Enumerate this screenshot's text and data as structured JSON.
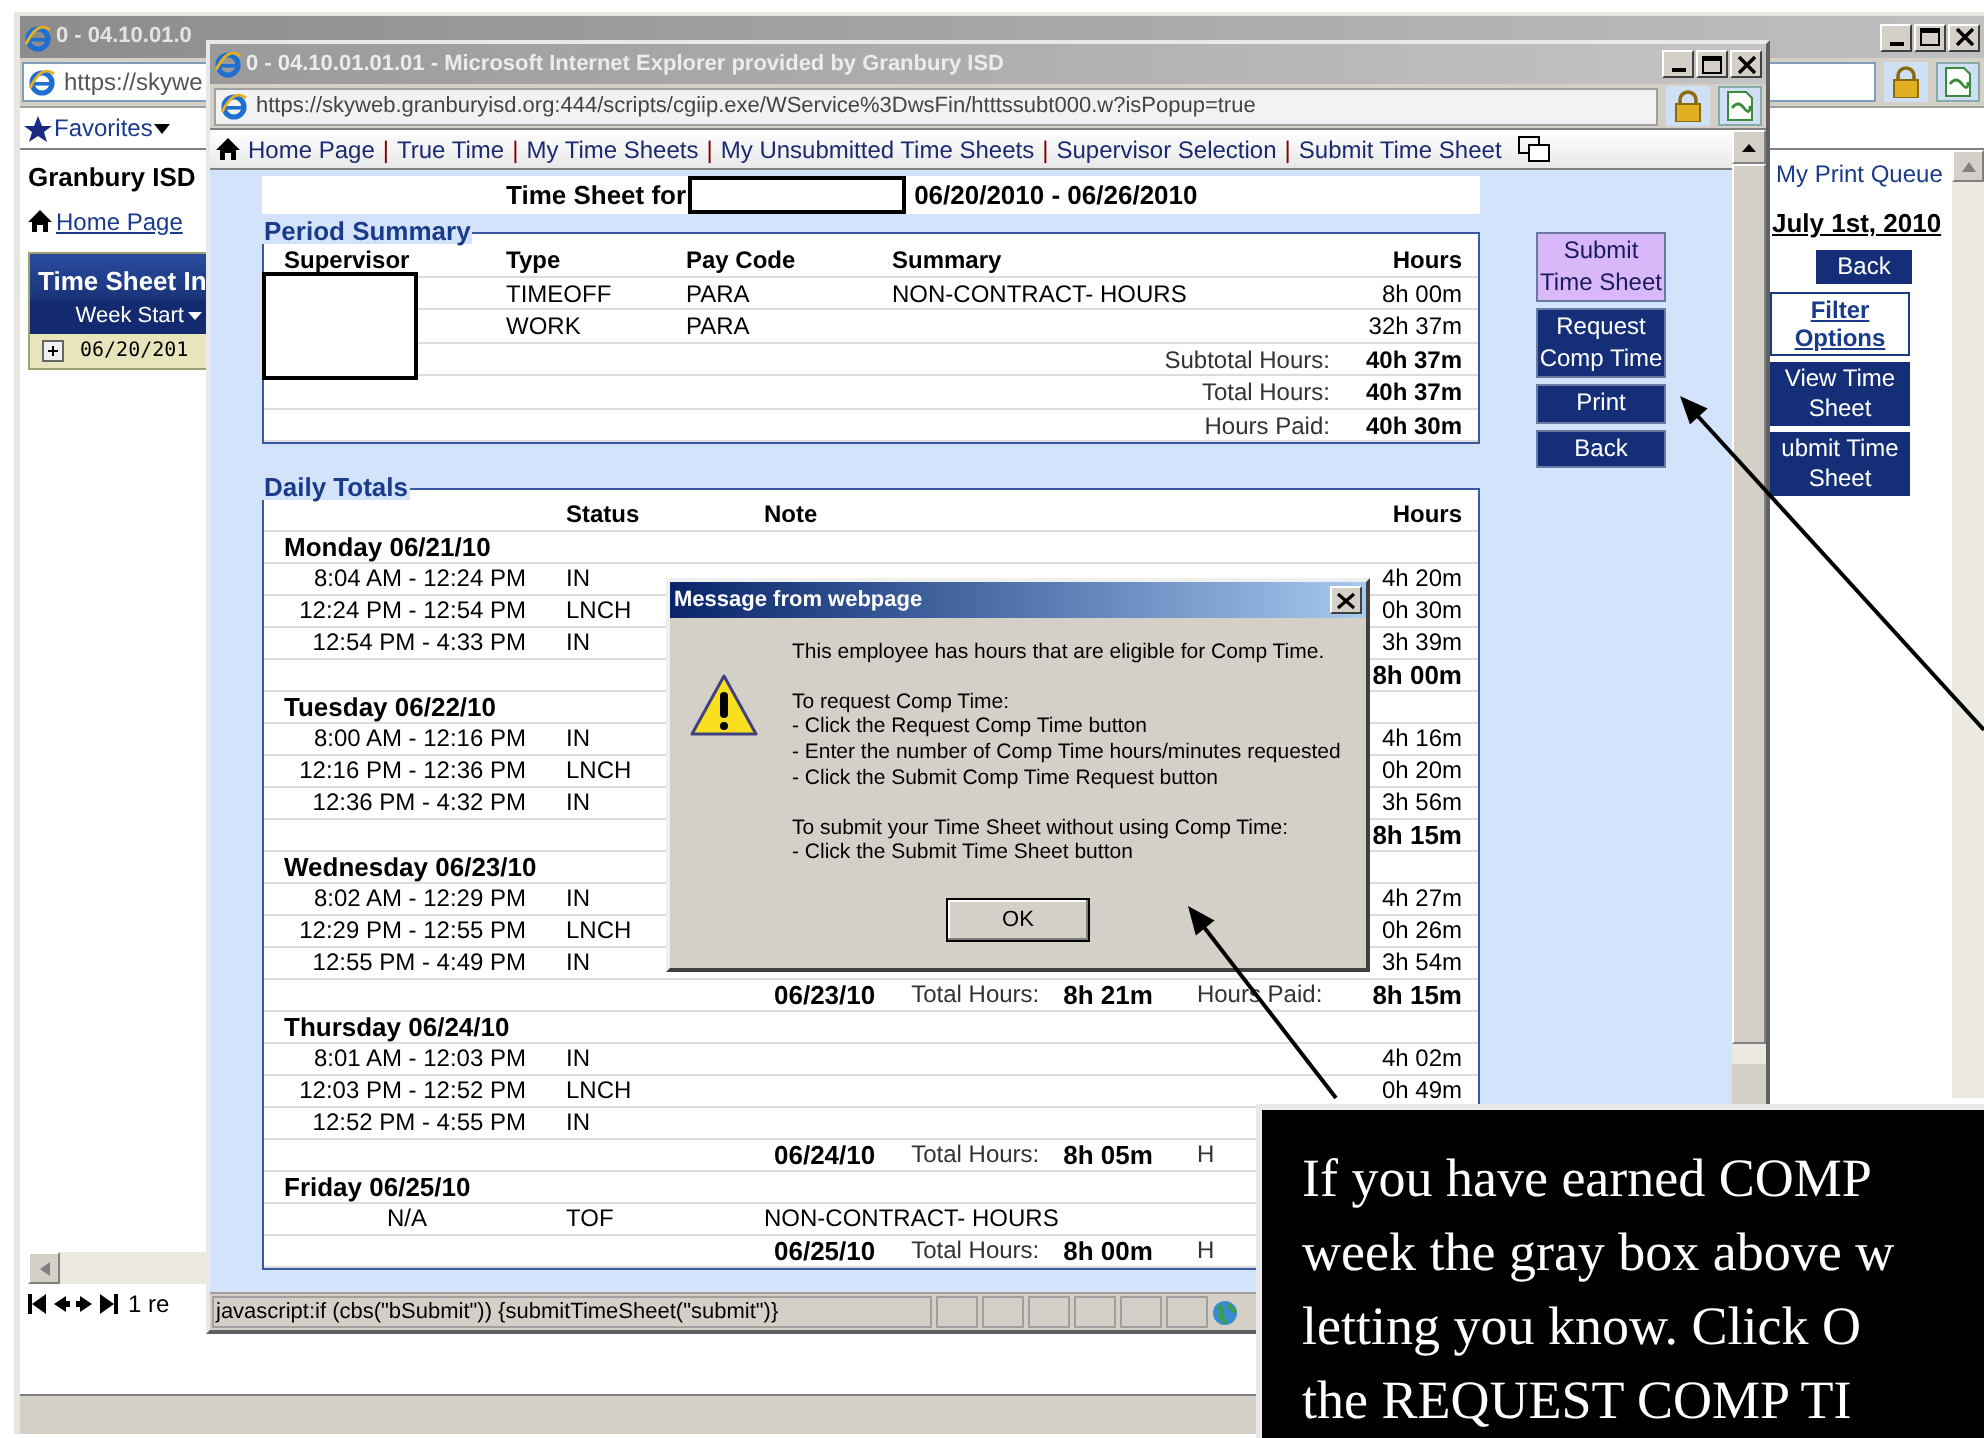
{
  "back_window": {
    "title": "0 - 04.10.01.0",
    "address": "https://skywe",
    "favorites": "Favorites",
    "organization": "Granbury ISD",
    "nav_link": "Home Page",
    "panel": {
      "title": "Time Sheet In",
      "column": "Week Start",
      "row": "06/20/201"
    },
    "print_queue": "My Print Queue",
    "date": "July 1st, 2010",
    "buttons": [
      {
        "label": "Back",
        "kind": "solid"
      },
      {
        "label": "Filter Options",
        "kind": "link"
      },
      {
        "label": "View Time Sheet",
        "kind": "solid"
      },
      {
        "label": "ubmit Time Sheet",
        "kind": "solid"
      }
    ],
    "pager": "1 re"
  },
  "popup_window": {
    "title": "0 - 04.10.01.01.01 - Microsoft Internet Explorer provided by Granbury ISD",
    "address": "https://skyweb.granburyisd.org:444/scripts/cgiip.exe/WService%3DwsFin/htttssubt000.w?isPopup=true",
    "nav_links": [
      "Home Page",
      "True Time",
      "My Time Sheets",
      "My Unsubmitted Time Sheets",
      "Supervisor Selection",
      "Submit Time Sheet"
    ],
    "nav_separators": [
      "|",
      "|",
      "|",
      "|",
      "|"
    ],
    "heading": {
      "label": "Time Sheet for",
      "period": "06/20/2010 - 06/26/2010"
    },
    "period_summary": {
      "legend": "Period Summary",
      "columns": [
        "Supervisor",
        "Type",
        "Pay Code",
        "Summary",
        "Hours"
      ],
      "rows": [
        {
          "type": "TIMEOFF",
          "pay_code": "PARA",
          "summary": "NON-CONTRACT- HOURS",
          "hours": "8h 00m"
        },
        {
          "type": "WORK",
          "pay_code": "PARA",
          "hours": "32h 37m"
        }
      ],
      "totals": [
        {
          "label": "Subtotal Hours:",
          "value": "40h 37m"
        },
        {
          "label": "Total Hours:",
          "value": "40h 37m"
        },
        {
          "label": "Hours Paid:",
          "value": "40h 30m"
        }
      ]
    },
    "daily_totals": {
      "legend": "Daily Totals",
      "columns": [
        "Status",
        "Note",
        "Hours"
      ],
      "days": [
        {
          "label": "Monday 06/21/10",
          "entries": [
            {
              "time": "8:04 AM - 12:24 PM",
              "status": "IN",
              "hours": "4h 20m"
            },
            {
              "time": "12:24 PM - 12:54 PM",
              "status": "LNCH",
              "hours": "0h 30m"
            },
            {
              "time": "12:54 PM - 4:33 PM",
              "status": "IN",
              "hours": "3h 39m"
            }
          ],
          "total": {
            "paid": "8h 00m"
          }
        },
        {
          "label": "Tuesday 06/22/10",
          "entries": [
            {
              "time": "8:00 AM - 12:16 PM",
              "status": "IN",
              "hours": "4h 16m"
            },
            {
              "time": "12:16 PM - 12:36 PM",
              "status": "LNCH",
              "hours": "0h 20m"
            },
            {
              "time": "12:36 PM - 4:32 PM",
              "status": "IN",
              "hours": "3h 56m"
            }
          ],
          "total": {
            "paid": "8h 15m"
          }
        },
        {
          "label": "Wednesday 06/23/10",
          "entries": [
            {
              "time": "8:02 AM - 12:29 PM",
              "status": "IN",
              "hours": "4h 27m"
            },
            {
              "time": "12:29 PM - 12:55 PM",
              "status": "LNCH",
              "hours": "0h 26m"
            },
            {
              "time": "12:55 PM - 4:49 PM",
              "status": "IN",
              "hours": "3h 54m"
            }
          ],
          "total": {
            "date": "06/23/10",
            "total_label": "Total Hours:",
            "total": "8h 21m",
            "paid_label": "Hours Paid:",
            "paid": "8h 15m"
          }
        },
        {
          "label": "Thursday 06/24/10",
          "entries": [
            {
              "time": "8:01 AM - 12:03 PM",
              "status": "IN",
              "hours": "4h 02m"
            },
            {
              "time": "12:03 PM - 12:52 PM",
              "status": "LNCH",
              "hours": "0h 49m"
            },
            {
              "time": "12:52 PM - 4:55 PM",
              "status": "IN"
            }
          ],
          "total": {
            "date": "06/24/10",
            "total_label": "Total Hours:",
            "total": "8h 05m",
            "paid_label": "H"
          }
        },
        {
          "label": "Friday 06/25/10",
          "entries": [
            {
              "time": "N/A",
              "status": "TOF",
              "note": "NON-CONTRACT- HOURS",
              "kind": "absence"
            }
          ],
          "total": {
            "date": "06/25/10",
            "total_label": "Total Hours:",
            "total": "8h 00m",
            "paid_label": "H"
          }
        }
      ]
    },
    "buttons": [
      {
        "label": "Submit Time Sheet",
        "highlighted": true
      },
      {
        "label": "Request Comp Time",
        "highlighted": false
      },
      {
        "label": "Print",
        "highlighted": false
      },
      {
        "label": "Back",
        "highlighted": false
      }
    ],
    "status_text": "javascript:if (cbs(\"bSubmit\")) {submitTimeSheet(\"submit\")}"
  },
  "dialog": {
    "title": "Message from webpage",
    "paragraphs": [
      [
        "This employee has hours that are eligible for Comp Time."
      ],
      [
        "To request Comp Time:",
        "- Click the Request Comp Time button",
        "- Enter the number of Comp Time hours/minutes requested",
        "- Click the Submit Comp Time Request button"
      ],
      [
        "To submit your Time Sheet without using Comp Time:",
        "- Click the Submit Time Sheet button"
      ]
    ],
    "button": "OK"
  },
  "callout": {
    "lines": [
      "If you have earned COMP",
      "week the gray box above w",
      "letting you know. Click O",
      "the REQUEST COMP TI"
    ]
  }
}
